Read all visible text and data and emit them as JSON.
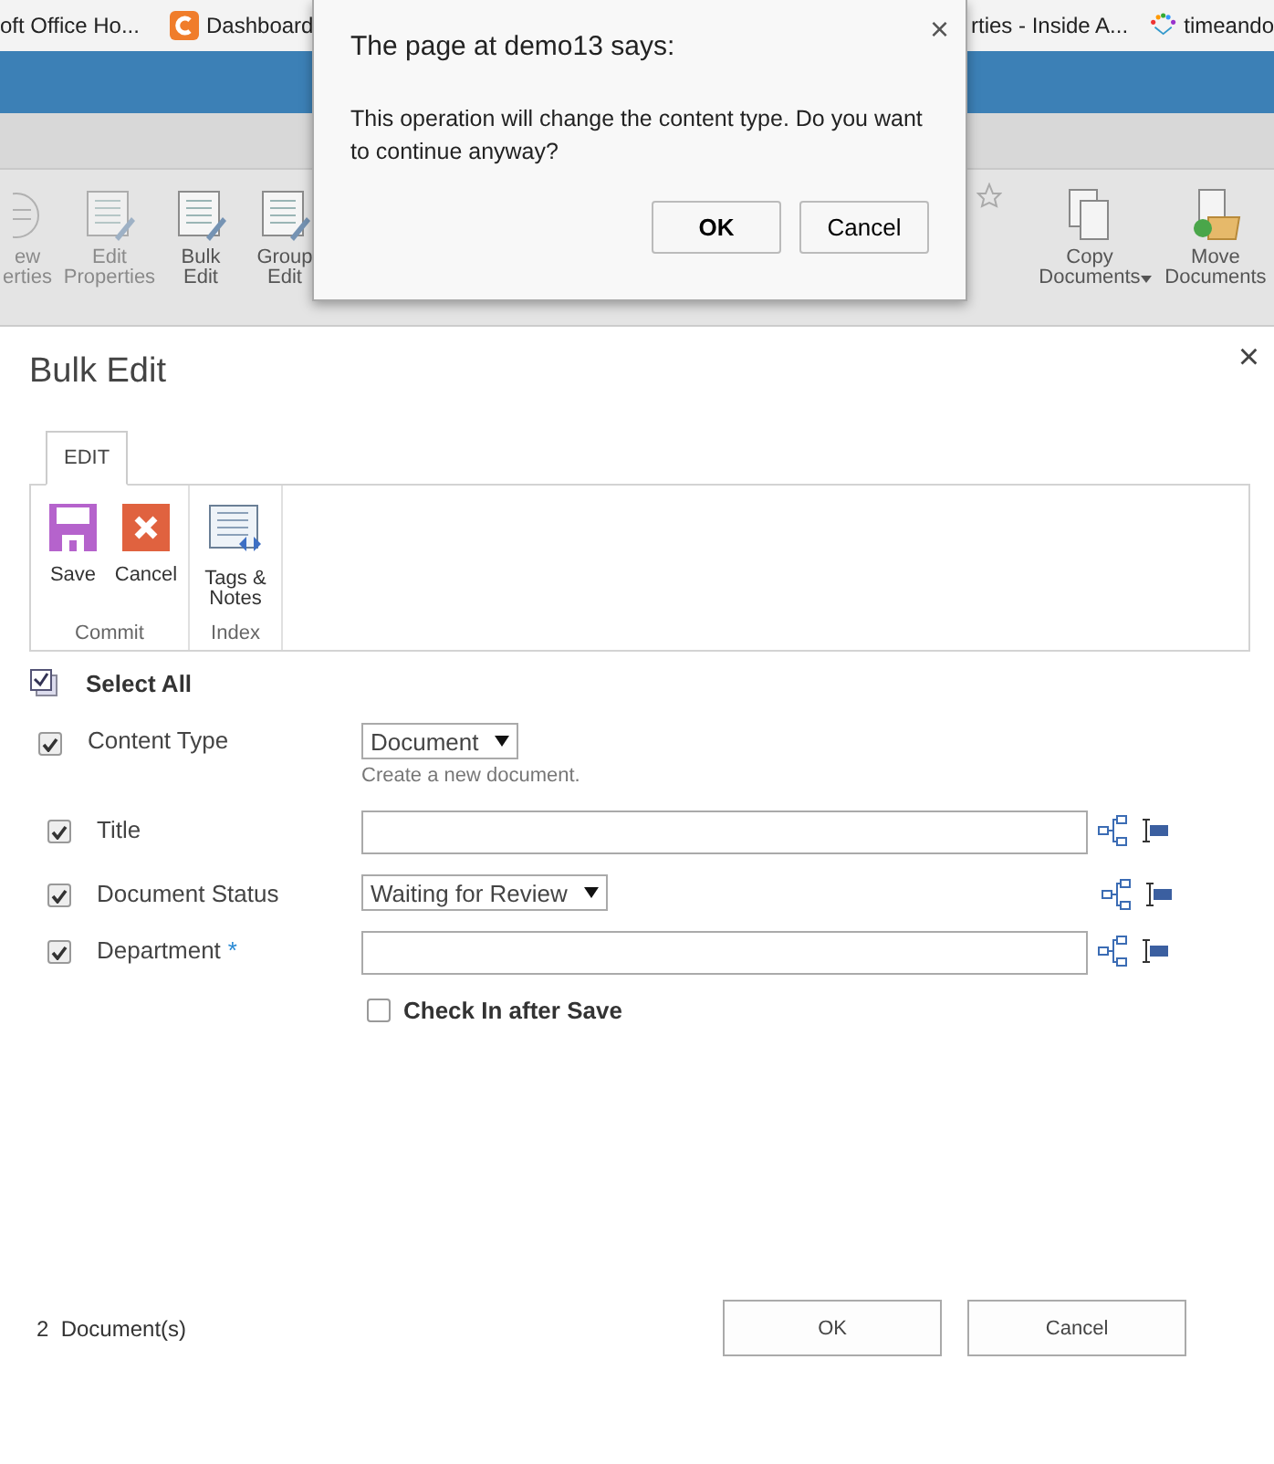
{
  "browser": {
    "bookmarks": [
      {
        "label": "oft Office Ho...",
        "kind": "plain"
      },
      {
        "label": "Dashboard",
        "kind": "app"
      },
      {
        "label": "rties - Inside A...",
        "kind": "plain"
      },
      {
        "label": "timeando",
        "kind": "logo"
      }
    ]
  },
  "background_ribbon": {
    "items": [
      {
        "lines": [
          "ew",
          "erties"
        ],
        "kind": "properties"
      },
      {
        "lines": [
          "Edit",
          "Properties"
        ],
        "kind": "edit"
      },
      {
        "lines": [
          "Bulk",
          "Edit"
        ],
        "kind": "bulk"
      },
      {
        "lines": [
          "Group",
          "Edit"
        ],
        "kind": "bulk"
      },
      {
        "lines": [
          "Copy",
          "Documents"
        ],
        "kind": "copy",
        "dropdown": true
      },
      {
        "lines": [
          "Move",
          "Documents"
        ],
        "kind": "move",
        "dropdown": false
      }
    ]
  },
  "alert": {
    "title": "The page at demo13 says:",
    "message": "This operation will change the content type. Do you want to continue anyway?",
    "close": "×",
    "buttons": [
      {
        "label": "OK",
        "default": true
      },
      {
        "label": "Cancel",
        "default": false
      }
    ]
  },
  "modal": {
    "title": "Bulk Edit",
    "close": "×",
    "tabs": [
      {
        "label": "EDIT",
        "selected": true
      }
    ],
    "groups": [
      {
        "label": "Commit",
        "buttons": [
          {
            "label": "Save",
            "kind": "save"
          },
          {
            "label": "Cancel",
            "kind": "cancel"
          }
        ]
      },
      {
        "label": "Index",
        "buttons": [
          {
            "label": "Tags & Notes",
            "kind": "tags"
          }
        ]
      }
    ],
    "select_all": "Select All",
    "fields": [
      {
        "label": "Content Type",
        "checked": true,
        "kind": "dropdown",
        "value": "Document",
        "hint": "Create a new document.",
        "icons": false
      },
      {
        "label": "Title",
        "checked": true,
        "kind": "text",
        "icons": true
      },
      {
        "label": "Document Status",
        "checked": true,
        "kind": "dropdown",
        "value": "Waiting for Review",
        "icons": true
      },
      {
        "label": "Department",
        "required_mark": "*",
        "checked": true,
        "kind": "text",
        "icons": true
      }
    ],
    "check_in": {
      "label": "Check In after Save",
      "checked": false
    },
    "footer": {
      "count": "2  Document(s)",
      "buttons": [
        {
          "label": "OK"
        },
        {
          "label": "Cancel"
        }
      ]
    }
  }
}
